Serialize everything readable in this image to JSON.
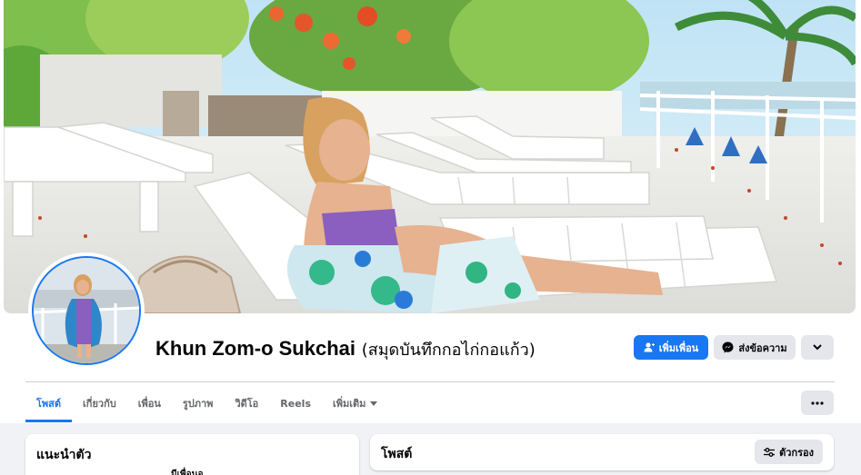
{
  "profile": {
    "name": "Khun Zom-o Sukchai",
    "alternate_name": "(สมุดบันทึกกอไก่กอแก้ว)"
  },
  "actions": {
    "add_friend_label": "เพิ่มเพื่อน",
    "message_label": "ส่งข้อความ",
    "more_icon": "chevron-down-icon"
  },
  "tabs": [
    {
      "label": "โพสต์",
      "active": true
    },
    {
      "label": "เกี่ยวกับ",
      "active": false
    },
    {
      "label": "เพื่อน",
      "active": false
    },
    {
      "label": "รูปภาพ",
      "active": false
    },
    {
      "label": "วิดีโอ",
      "active": false
    },
    {
      "label": "Reels",
      "active": false
    },
    {
      "label": "เพิ่มเติม",
      "active": false
    }
  ],
  "intro": {
    "title": "แนะนำตัว",
    "partial_text": "มีเพื่อนอ"
  },
  "posts_section": {
    "title": "โพสต์",
    "filter_label": "ตัวกรอง"
  },
  "colors": {
    "accent": "#1877f2",
    "button_gray": "#e4e6eb",
    "page_bg": "#f0f2f5"
  }
}
